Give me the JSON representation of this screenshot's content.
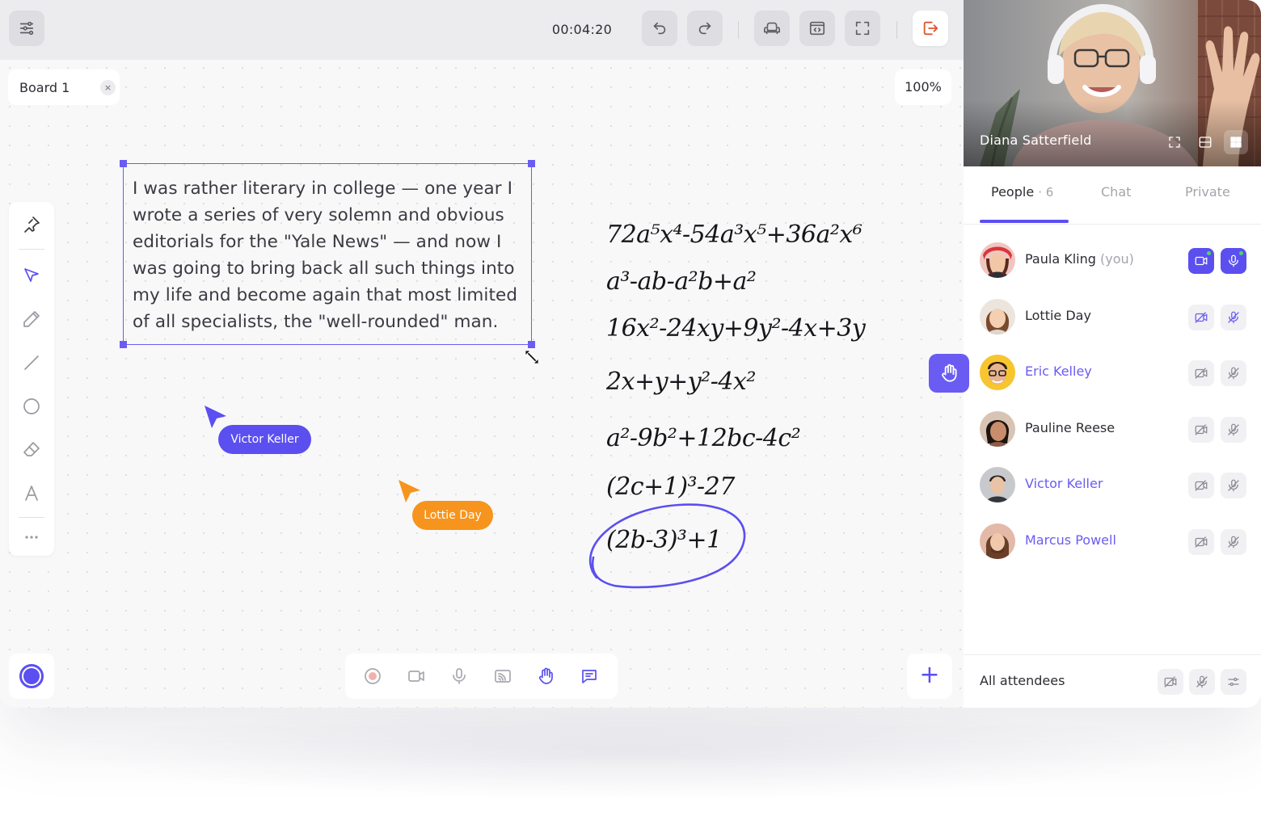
{
  "toolbar": {
    "timer": "00:04:20",
    "icons": [
      "settings-sliders-icon",
      "undo-icon",
      "redo-icon",
      "sofa-icon",
      "code-window-icon",
      "fullscreen-icon",
      "leave-icon"
    ]
  },
  "board": {
    "tab_label": "Board 1",
    "close_glyph": "×",
    "zoom": "100%"
  },
  "note": {
    "text": " I was rather literary in college — one year I wrote a series of very solemn and obvious editorials for the \"Yale News\" — and now I was going to bring back all such things into my life and become again that most limited of all specialists, the \"well-rounded\" man."
  },
  "cursors": [
    {
      "name": "Victor Keller",
      "color": "#5b4ff0"
    },
    {
      "name": "Lottie Day",
      "color": "#f7941d"
    }
  ],
  "math_lines": [
    "72a⁵x⁴-54a³x⁵+36a²x⁶",
    "a³-ab-a²b+a²",
    "16x²-24xy+9y²-4x+3y",
    "2x+y+y²-4x²",
    "a²-9b²+12bc-4c²",
    "(2c+1)³-27",
    "(2b-3)³+1"
  ],
  "accent_color": "#5b4ff0",
  "video": {
    "speaker": "Diana Satterfield"
  },
  "tabs": [
    {
      "label": "People",
      "count": "· 6"
    },
    {
      "label": "Chat"
    },
    {
      "label": "Private"
    }
  ],
  "people": [
    {
      "name": "Paula Kling",
      "suffix": "(you)",
      "highlight": false,
      "camera_on": true,
      "mic_on": true
    },
    {
      "name": "Lottie Day",
      "highlight": false,
      "camera_on": false,
      "mic_on": false
    },
    {
      "name": "Eric Kelley",
      "highlight": true,
      "camera_on": false,
      "mic_on": false,
      "hand_raised": true
    },
    {
      "name": "Pauline Reese",
      "highlight": false,
      "camera_on": false,
      "mic_on": false
    },
    {
      "name": "Victor Keller",
      "highlight": true,
      "camera_on": false,
      "mic_on": false
    },
    {
      "name": "Marcus Powell",
      "highlight": true,
      "camera_on": false,
      "mic_on": false
    }
  ],
  "footer": {
    "label": "All attendees"
  },
  "add_glyph": "+"
}
